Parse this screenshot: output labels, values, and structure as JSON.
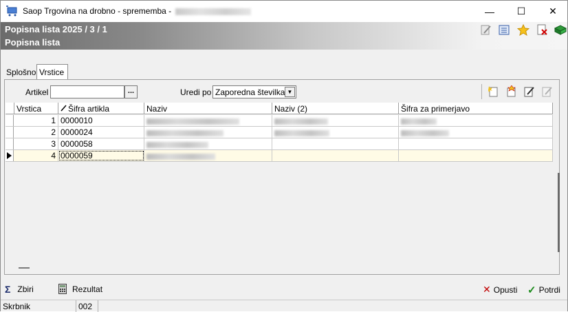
{
  "window": {
    "title": "Saop Trgovina na drobno - sprememba -",
    "minimize": "—",
    "maximize": "☐",
    "close": "✕"
  },
  "header": {
    "title": "Popisna lista 2025 / 3 / 1",
    "subtitle": "Popisna lista"
  },
  "tabs": [
    {
      "label": "Splošno"
    },
    {
      "label": "Vrstice"
    }
  ],
  "filter": {
    "artikel_label": "Artikel",
    "artikel_value": "",
    "dots_label": "...",
    "uredi_label": "Uredi po",
    "uredi_value": "Zaporedna številka"
  },
  "grid": {
    "columns": [
      "Vrstica",
      "Šifra artikla",
      "Naziv",
      "Naziv (2)",
      "Šifra za primerjavo"
    ],
    "rows": [
      {
        "vrstica": "1",
        "sifra": "0000010"
      },
      {
        "vrstica": "2",
        "sifra": "0000024"
      },
      {
        "vrstica": "3",
        "sifra": "0000058"
      },
      {
        "vrstica": "4",
        "sifra": "0000059"
      }
    ]
  },
  "bottom": {
    "zbiri": "Zbiri",
    "rezultat": "Rezultat",
    "opusti": "Opusti",
    "potrdi": "Potrdi"
  },
  "status": {
    "user": "Skrbnik",
    "code": "002"
  },
  "colors": {
    "accent_green": "#1a8a1a",
    "cancel_red": "#c00000",
    "selected_row": "#fffbe6"
  }
}
